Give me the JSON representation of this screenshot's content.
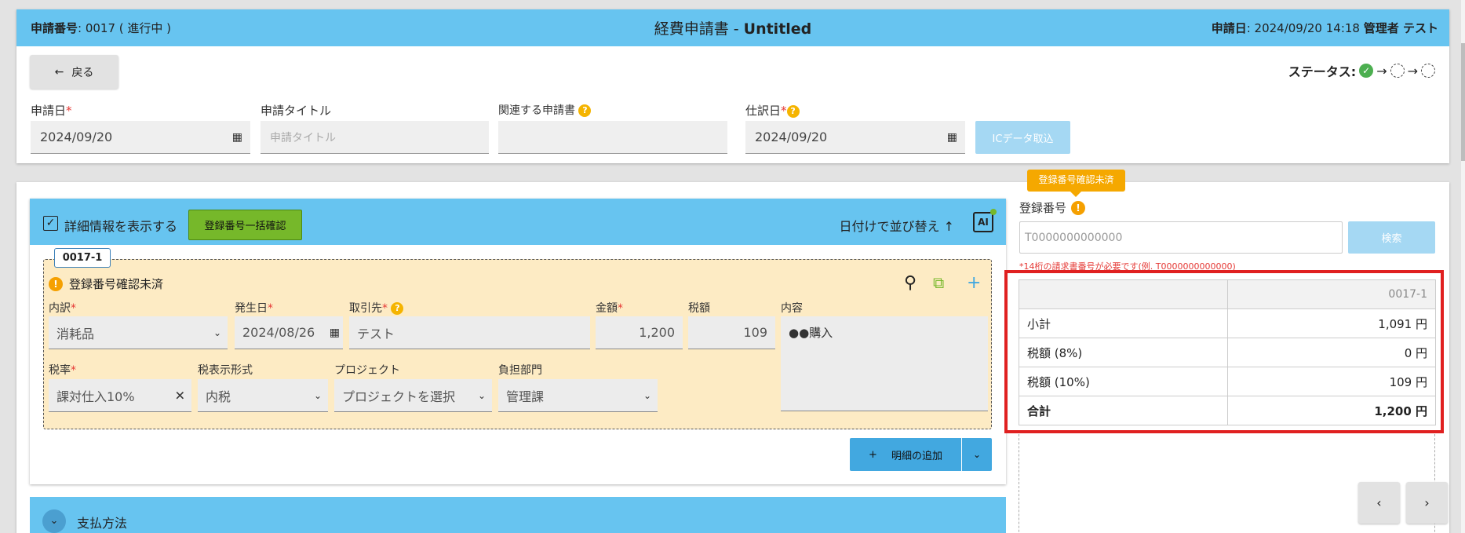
{
  "header": {
    "app_no_label": "申請番号",
    "app_no_value": ": 0017 ( 進行中 )",
    "title_prefix": "経費申請書 - ",
    "title_name": "Untitled",
    "date_label": "申請日",
    "date_value": ": 2024/09/20 14:18",
    "user_label": "管理者 テスト"
  },
  "toolbar": {
    "back_label": "戻る",
    "status_label": "ステータス:"
  },
  "form": {
    "apply_date_label": "申請日",
    "apply_date_value": "2024/09/20",
    "title_label": "申請タイトル",
    "title_placeholder": "申請タイトル",
    "related_label": "関連する申請書",
    "journal_date_label": "仕訳日",
    "journal_date_value": "2024/09/20",
    "ic_button": "ICデータ取込"
  },
  "details": {
    "show_detail_label": "詳細情報を表示する",
    "bulk_confirm_button": "登録番号一括確認",
    "sort_label": "日付けで並び替え",
    "ai_label": "AI",
    "entry": {
      "tag": "0017-1",
      "warning": "登録番号確認未済",
      "category_label": "内訳",
      "category_value": "消耗品",
      "date_label": "発生日",
      "date_value": "2024/08/26",
      "vendor_label": "取引先",
      "vendor_value": "テスト",
      "amount_label": "金額",
      "amount_value": "1,200",
      "tax_label": "税額",
      "tax_value": "109",
      "content_label": "内容",
      "content_value": "●●購入",
      "rate_label": "税率",
      "rate_value": "課対仕入10%",
      "tax_display_label": "税表示形式",
      "tax_display_value": "内税",
      "project_label": "プロジェクト",
      "project_value": "プロジェクトを選択",
      "dept_label": "負担部門",
      "dept_value": "管理課"
    },
    "add_button": "明細の追加"
  },
  "payment": {
    "label": "支払方法"
  },
  "registration": {
    "tooltip": "登録番号確認未済",
    "label": "登録番号",
    "input_placeholder": "T0000000000000",
    "search_button": "検索",
    "hint": "*14桁の請求書番号が必要です(例. T0000000000000)"
  },
  "summary": {
    "column": "0017-1",
    "rows": [
      {
        "label": "小計",
        "value": "1,091 円"
      },
      {
        "label": "税額 (8%)",
        "value": "0 円"
      },
      {
        "label": "税額 (10%)",
        "value": "109 円"
      },
      {
        "label": "合計",
        "value": "1,200 円"
      }
    ]
  }
}
